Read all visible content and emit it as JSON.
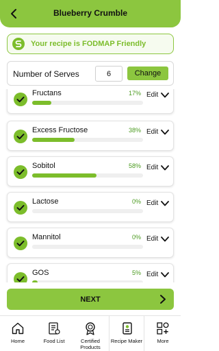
{
  "header": {
    "title": "Blueberry Crumble",
    "back_icon": "chevron-left-icon",
    "color": "#8cc63f"
  },
  "banner": {
    "text": "Your recipe is FODMAP Friendly",
    "icon": "fodmap-logo-icon"
  },
  "serves": {
    "label": "Number of Serves",
    "value": "6",
    "button": "Change"
  },
  "components": [
    {
      "name": "Fructans",
      "percent_text": "17%",
      "percent": 17,
      "edit": "Edit"
    },
    {
      "name": "Excess Fructose",
      "percent_text": "38%",
      "percent": 38,
      "edit": "Edit"
    },
    {
      "name": "Sobitol",
      "percent_text": "58%",
      "percent": 58,
      "edit": "Edit"
    },
    {
      "name": "Lactose",
      "percent_text": "0%",
      "percent": 0,
      "edit": "Edit"
    },
    {
      "name": "Mannitol",
      "percent_text": "0%",
      "percent": 0,
      "edit": "Edit"
    },
    {
      "name": "GOS",
      "percent_text": "5%",
      "percent": 5,
      "edit": "Edit"
    }
  ],
  "next": {
    "label": "NEXT"
  },
  "nav": [
    {
      "label": "Home",
      "icon": "home-icon"
    },
    {
      "label": "Food List",
      "icon": "food-list-icon"
    },
    {
      "label": "Certified Products",
      "icon": "certified-products-icon"
    },
    {
      "label": "Recipe Maker",
      "icon": "recipe-maker-icon",
      "active": true
    },
    {
      "label": "More",
      "icon": "more-icon"
    }
  ],
  "colors": {
    "accent": "#8cc63f",
    "progress": "#7cbd2b",
    "percent_text": "#4a9a1f"
  }
}
